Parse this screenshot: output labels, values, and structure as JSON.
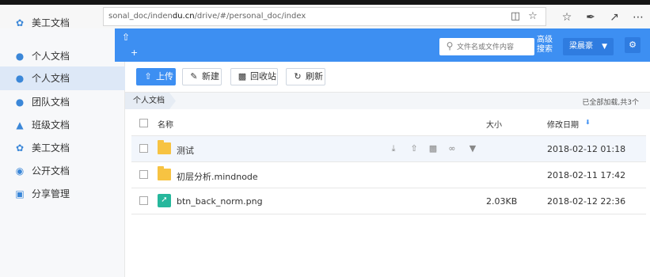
{
  "browser": {
    "address_prefix": "sonal_doc/indexdu.cn/drive/#/personal_doc/index",
    "addr_bold": "du.cn",
    "addr_tail": "/drive/#/personal_doc/index",
    "addr_head": "sonal_doc/inden"
  },
  "ghost_rows": {
    "row1": "美工文档",
    "row2": "个人文档"
  },
  "header": {
    "plus": "+",
    "search_placeholder": "文件名或文件内容",
    "advanced_search": "高级搜索",
    "user_name": "梁晨豪"
  },
  "sidebar": {
    "items": [
      {
        "label": "个人文档",
        "icon": "person-icon"
      },
      {
        "label": "团队文档",
        "icon": "team-icon"
      },
      {
        "label": "班级文档",
        "icon": "org-icon"
      },
      {
        "label": "美工文档",
        "icon": "art-icon"
      },
      {
        "label": "公开文档",
        "icon": "eye-icon"
      },
      {
        "label": "分享管理",
        "icon": "share-icon"
      }
    ]
  },
  "toolbar": {
    "upload": "上传",
    "new": "新建",
    "recycle": "回收站",
    "refresh": "刷新"
  },
  "breadcrumb": {
    "current": "个人文档",
    "status": "已全部加载,共3个"
  },
  "table": {
    "headers": {
      "name": "名称",
      "size": "大小",
      "date": "修改日期"
    },
    "rows": [
      {
        "name": "测试",
        "size": "",
        "date": "2018-02-12 01:18",
        "type": "folder"
      },
      {
        "name": "初层分析.mindnode",
        "size": "",
        "date": "2018-02-11 17:42",
        "type": "folder"
      },
      {
        "name": "btn_back_norm.png",
        "size": "2.03KB",
        "date": "2018-02-12 22:36",
        "type": "image"
      }
    ]
  },
  "colors": {
    "accent": "#3d8ff2",
    "sidebar_active": "#dde8f7",
    "folder": "#f7c342",
    "image_file": "#26b79c"
  }
}
